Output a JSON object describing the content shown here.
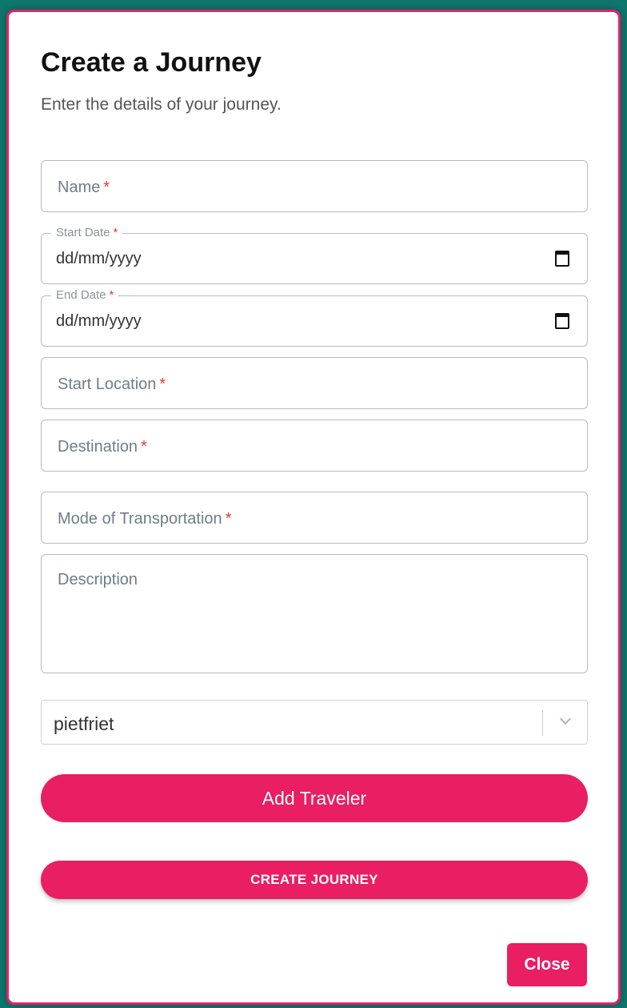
{
  "modal": {
    "title": "Create a Journey",
    "subtitle": "Enter the details of your journey."
  },
  "form": {
    "name_label": "Name",
    "start_date_label": "Start Date",
    "start_date_value": "dd/mm/yyyy",
    "end_date_label": "End Date",
    "end_date_value": "dd/mm/yyyy",
    "start_location_label": "Start Location",
    "destination_label": "Destination",
    "transport_label": "Mode of Transportation",
    "description_label": "Description",
    "required_marker": "*",
    "traveler_select_value": "pietfriet"
  },
  "buttons": {
    "add_traveler": "Add Traveler",
    "create_journey": "CREATE JOURNEY",
    "close": "Close"
  },
  "colors": {
    "accent": "#e91e63",
    "backdrop": "#0f766e",
    "required": "#e53935"
  },
  "icons": {
    "date_picker": "calendar-icon",
    "dropdown": "chevron-down-icon"
  }
}
